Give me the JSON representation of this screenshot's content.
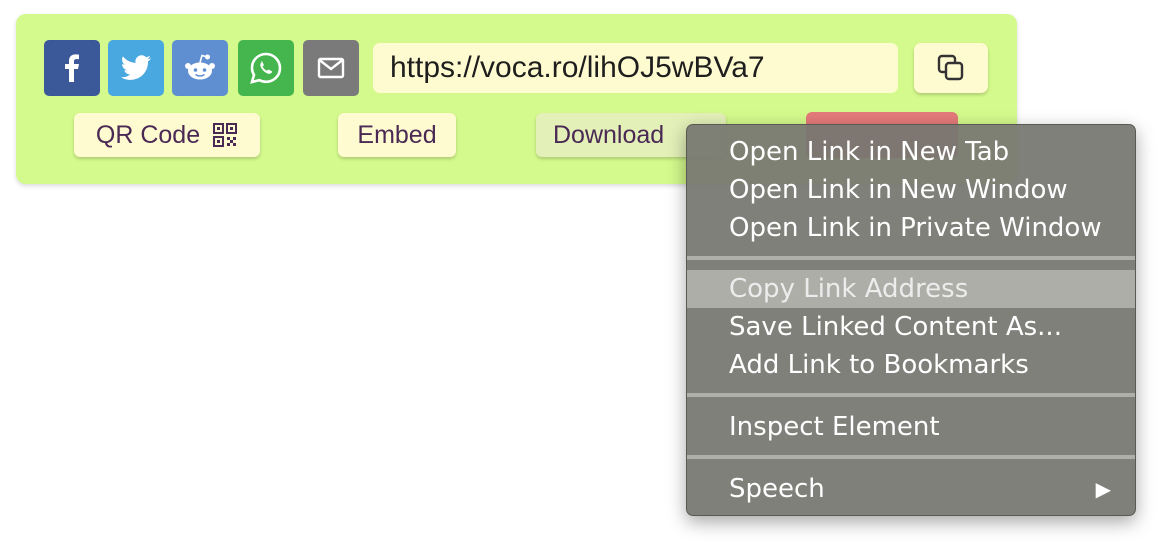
{
  "share": {
    "buttons": [
      {
        "name": "facebook",
        "color": "#3b5998",
        "icon": "facebook-icon"
      },
      {
        "name": "twitter",
        "color": "#4aa8e0",
        "icon": "twitter-icon"
      },
      {
        "name": "reddit",
        "color": "#5f8fd0",
        "icon": "reddit-icon"
      },
      {
        "name": "whatsapp",
        "color": "#45b54d",
        "icon": "whatsapp-icon"
      },
      {
        "name": "email",
        "color": "#7a7a7a",
        "icon": "mail-icon"
      }
    ],
    "url": "https://voca.ro/lihOJ5wBVa7",
    "copy_icon": "copy-icon"
  },
  "actions": {
    "qr_label": "QR Code",
    "qr_icon": "qr-code-icon",
    "embed_label": "Embed",
    "download_label": "Download"
  },
  "context_menu": {
    "open_new_tab": "Open Link in New Tab",
    "open_new_window": "Open Link in New Window",
    "open_private_window": "Open Link in Private Window",
    "copy_link": "Copy Link Address",
    "save_linked": "Save Linked Content As...",
    "add_bookmark": "Add Link to Bookmarks",
    "inspect": "Inspect Element",
    "speech": "Speech",
    "speech_arrow": "▶",
    "highlighted_item": "Copy Link Address"
  },
  "colors": {
    "panel": "#d4f98c",
    "field": "#fffbd0",
    "menu": "#767670",
    "menu_highlight": "#aeaea8"
  }
}
